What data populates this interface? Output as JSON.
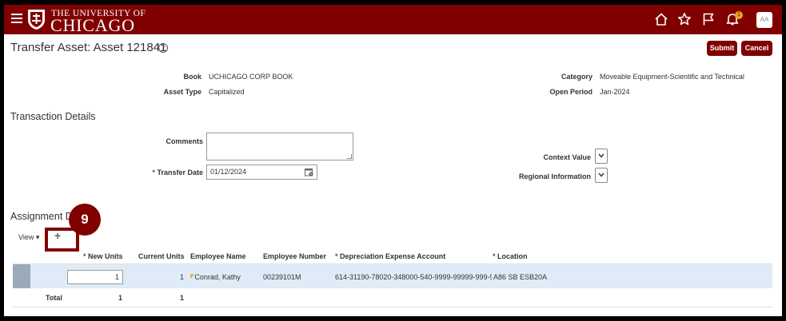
{
  "header": {
    "logo_line1": "THE UNIVERSITY OF",
    "logo_line2": "CHICAGO",
    "notification_count": "1",
    "avatar_initials": "AA"
  },
  "page": {
    "title": "Transfer Asset: Asset 121841",
    "help": "?",
    "submit_label": "Submit",
    "cancel_label": "Cancel"
  },
  "asset": {
    "book_label": "Book",
    "book_value": "UCHICAGO CORP BOOK",
    "asset_type_label": "Asset Type",
    "asset_type_value": "Capitalized",
    "category_label": "Category",
    "category_value": "Moveable Equipment-Scientific and Technical",
    "open_period_label": "Open Period",
    "open_period_value": "Jan-2024"
  },
  "transaction": {
    "section_title": "Transaction Details",
    "comments_label": "Comments",
    "transfer_date_label": "Transfer Date",
    "transfer_date_value": "01/12/2024",
    "context_value_label": "Context Value",
    "regional_info_label": "Regional Information"
  },
  "assignment": {
    "section_title": "Assignment D",
    "view_label": "View",
    "columns": [
      "New Units",
      "Current Units",
      "Employee Name",
      "Employee Number",
      "Depreciation Expense Account",
      "Location"
    ],
    "row": {
      "new_units": "1",
      "current_units": "1",
      "employee_name": "Conrad, Kathy",
      "employee_number": "00239101M",
      "account": "614-31190-78020-348000-540-9999-99999-999-999-",
      "location": "A86 SB ESB20A"
    },
    "total_label": "Total",
    "total_new_units": "1",
    "total_current_units": "1"
  },
  "callout": {
    "step": "9"
  },
  "colors": {
    "brand": "#800000",
    "selected_row": "#dfecf7",
    "required": "#1f5fa8"
  }
}
